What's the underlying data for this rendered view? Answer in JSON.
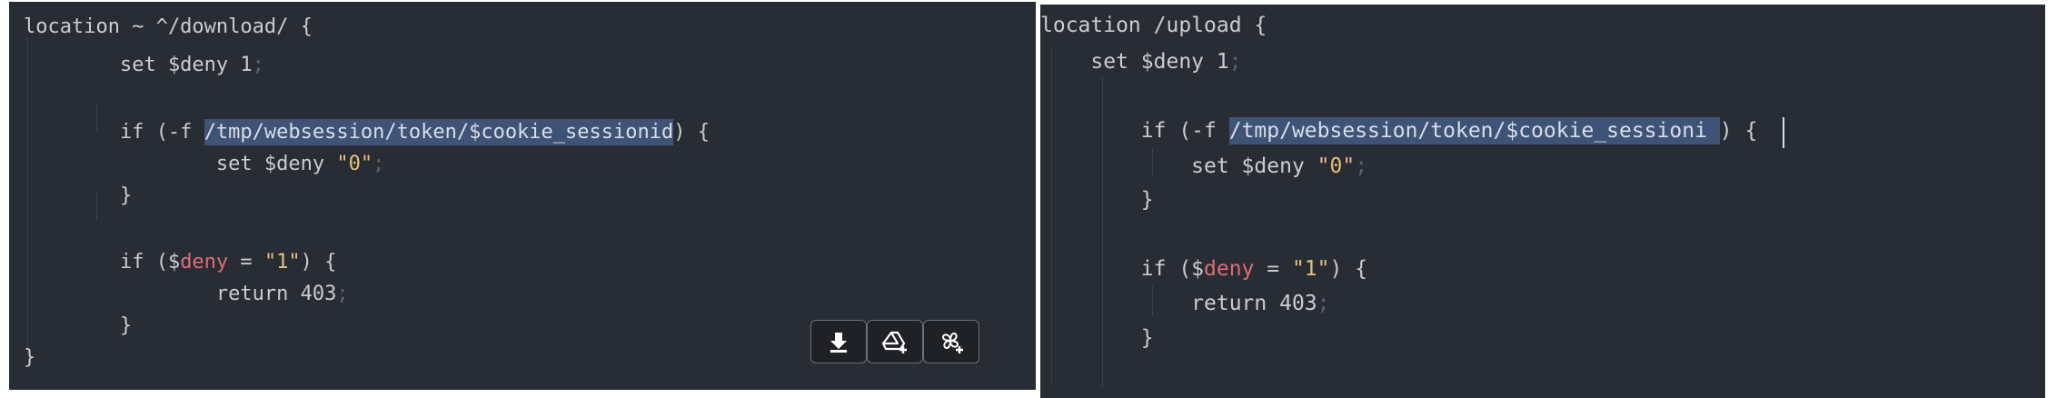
{
  "left_pane": {
    "lines": [
      {
        "id": "l1",
        "segments": [
          {
            "t": "location ~ ^/download/ {",
            "c": "plain"
          }
        ]
      },
      {
        "id": "l2",
        "segments": [
          {
            "t": "        set $deny 1",
            "c": "plain"
          },
          {
            "t": ";",
            "c": "punct"
          }
        ]
      },
      {
        "id": "l3",
        "segments": [
          {
            "t": "        if (-f ",
            "c": "plain"
          },
          {
            "t": "/tmp/websession/token/$cookie_sessionid",
            "c": "sel"
          },
          {
            "t": ") {",
            "c": "plain"
          }
        ]
      },
      {
        "id": "l4",
        "segments": [
          {
            "t": "                set $deny ",
            "c": "plain"
          },
          {
            "t": "\"0\"",
            "c": "str"
          },
          {
            "t": ";",
            "c": "punct"
          }
        ]
      },
      {
        "id": "l5",
        "segments": [
          {
            "t": "        }",
            "c": "plain"
          }
        ]
      },
      {
        "id": "l6",
        "segments": [
          {
            "t": "        if ($",
            "c": "plain"
          },
          {
            "t": "deny",
            "c": "var"
          },
          {
            "t": " = ",
            "c": "plain"
          },
          {
            "t": "\"1\"",
            "c": "str"
          },
          {
            "t": ") {",
            "c": "plain"
          }
        ]
      },
      {
        "id": "l7",
        "segments": [
          {
            "t": "                return 403",
            "c": "plain"
          },
          {
            "t": ";",
            "c": "punct"
          }
        ]
      },
      {
        "id": "l8",
        "segments": [
          {
            "t": "        }",
            "c": "plain"
          }
        ]
      },
      {
        "id": "l9",
        "segments": [
          {
            "t": "}",
            "c": "plain"
          }
        ]
      }
    ]
  },
  "right_pane": {
    "lines": [
      {
        "id": "r1",
        "segments": [
          {
            "t": "location /upload {",
            "c": "plain"
          }
        ]
      },
      {
        "id": "r2",
        "segments": [
          {
            "t": "    set $deny 1",
            "c": "plain"
          },
          {
            "t": ";",
            "c": "punct"
          }
        ]
      },
      {
        "id": "r3",
        "segments": [
          {
            "t": "        if (-f ",
            "c": "plain"
          },
          {
            "t": "/tmp/websession/token/$cookie_sessioni ",
            "c": "sel"
          },
          {
            "t": ") {",
            "c": "plain"
          }
        ]
      },
      {
        "id": "r4",
        "segments": [
          {
            "t": "            set $deny ",
            "c": "plain"
          },
          {
            "t": "\"0\"",
            "c": "str"
          },
          {
            "t": ";",
            "c": "punct"
          }
        ]
      },
      {
        "id": "r5",
        "segments": [
          {
            "t": "        }",
            "c": "plain"
          }
        ]
      },
      {
        "id": "r6",
        "segments": [
          {
            "t": "        if ($",
            "c": "plain"
          },
          {
            "t": "deny",
            "c": "var"
          },
          {
            "t": " = ",
            "c": "plain"
          },
          {
            "t": "\"1\"",
            "c": "str"
          },
          {
            "t": ") {",
            "c": "plain"
          }
        ]
      },
      {
        "id": "r7",
        "segments": [
          {
            "t": "            return 403",
            "c": "plain"
          },
          {
            "t": ";",
            "c": "punct"
          }
        ]
      },
      {
        "id": "r8",
        "segments": [
          {
            "t": "        }",
            "c": "plain"
          }
        ]
      }
    ]
  },
  "toolbar": {
    "buttons": [
      {
        "name": "download-button",
        "icon": "download-arrow-icon"
      },
      {
        "name": "add-to-drive-button",
        "icon": "drive-plus-icon"
      },
      {
        "name": "add-to-photos-button",
        "icon": "pinwheel-plus-icon"
      }
    ]
  },
  "colors": {
    "editor_background": "#282c34",
    "plain_text": "#c9ccd3",
    "variable": "#e06c75",
    "string": "#e5c07b",
    "selection": "#3f5377"
  }
}
